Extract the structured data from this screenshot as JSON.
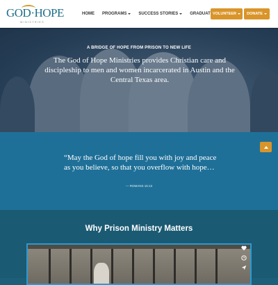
{
  "brand": {
    "logo_main": "GOD·HOPE",
    "logo_sub": "MINISTRIES"
  },
  "nav": {
    "items": [
      {
        "label": "HOME",
        "dropdown": false
      },
      {
        "label": "PROGRAMS",
        "dropdown": true
      },
      {
        "label": "SUCCESS STORIES",
        "dropdown": true
      },
      {
        "label": "GRADUATES",
        "dropdown": true
      }
    ],
    "volunteer_label": "VOLUNTEER",
    "donate_label": "DONATE"
  },
  "hero": {
    "eyebrow": "A BRIDGE OF HOPE FROM PRISON TO NEW LIFE",
    "text": "The God of Hope Ministries provides Christian care and discipleship to men and women incarcerated in Austin and the Central Texas area."
  },
  "quote": {
    "text": "“May the God of hope fill you with joy and peace as you believe, so that you overflow with hope…",
    "reference": "— ROMANS 15:13"
  },
  "ministry": {
    "title": "Why Prison Ministry Matters"
  },
  "icons": {
    "scroll_top": "arrow-up-icon",
    "like": "heart-icon",
    "later": "clock-icon",
    "share": "send-icon"
  },
  "colors": {
    "accent": "#d9952a",
    "quote_band": "#1f7098",
    "section": "#1b5a73",
    "brand_blue": "#1f6e8c"
  }
}
